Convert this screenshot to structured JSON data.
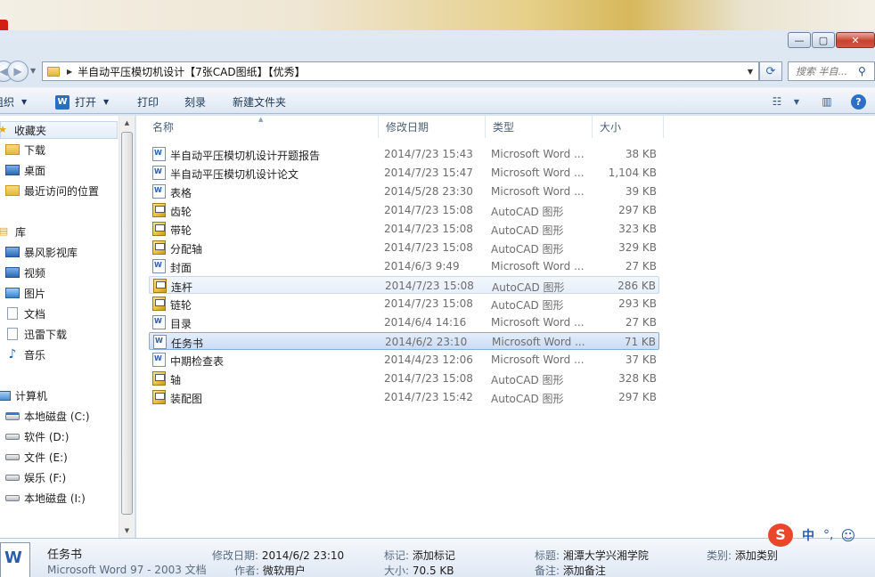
{
  "window": {
    "minimize_glyph": "—",
    "maximize_glyph": "▢",
    "close_glyph": "✕"
  },
  "address": {
    "path": "半自动平压模切机设计【7张CAD图纸】【优秀】",
    "search_placeholder": "搜索 半自..."
  },
  "toolbar": {
    "organize": "组织",
    "open": "打开",
    "print": "打印",
    "burn": "刻录",
    "new_folder": "新建文件夹"
  },
  "navigation": {
    "favorites": "收藏夹",
    "downloads": "下载",
    "desktop": "桌面",
    "recent": "最近访问的位置",
    "libraries": "库",
    "baofeng": "暴风影视库",
    "video": "视频",
    "pictures": "图片",
    "documents": "文档",
    "xunlei": "迅雷下载",
    "music": "音乐",
    "computer": "计算机",
    "drive_c": "本地磁盘 (C:)",
    "drive_d": "软件 (D:)",
    "drive_e": "文件 (E:)",
    "drive_f": "娱乐 (F:)",
    "drive_i": "本地磁盘 (I:)"
  },
  "columns": {
    "name": "名称",
    "modified": "修改日期",
    "type": "类型",
    "size": "大小"
  },
  "files": [
    {
      "name": "半自动平压模切机设计开题报告",
      "date": "2014/7/23 15:43",
      "type": "Microsoft Word ...",
      "size": "38 KB",
      "icon": "word-icon"
    },
    {
      "name": "半自动平压模切机设计论文",
      "date": "2014/7/23 15:47",
      "type": "Microsoft Word ...",
      "size": "1,104 KB",
      "icon": "word-icon"
    },
    {
      "name": "表格",
      "date": "2014/5/28 23:30",
      "type": "Microsoft Word ...",
      "size": "39 KB",
      "icon": "word-icon"
    },
    {
      "name": "齿轮",
      "date": "2014/7/23 15:08",
      "type": "AutoCAD 图形",
      "size": "297 KB",
      "icon": "autocad-icon"
    },
    {
      "name": "带轮",
      "date": "2014/7/23 15:08",
      "type": "AutoCAD 图形",
      "size": "323 KB",
      "icon": "autocad-icon"
    },
    {
      "name": "分配轴",
      "date": "2014/7/23 15:08",
      "type": "AutoCAD 图形",
      "size": "329 KB",
      "icon": "autocad-icon"
    },
    {
      "name": "封面",
      "date": "2014/6/3 9:49",
      "type": "Microsoft Word ...",
      "size": "27 KB",
      "icon": "word-icon"
    },
    {
      "name": "连杆",
      "date": "2014/7/23 15:08",
      "type": "AutoCAD 图形",
      "size": "286 KB",
      "icon": "autocad-icon"
    },
    {
      "name": "链轮",
      "date": "2014/7/23 15:08",
      "type": "AutoCAD 图形",
      "size": "293 KB",
      "icon": "autocad-icon"
    },
    {
      "name": "目录",
      "date": "2014/6/4 14:16",
      "type": "Microsoft Word ...",
      "size": "27 KB",
      "icon": "word-icon"
    },
    {
      "name": "任务书",
      "date": "2014/6/2 23:10",
      "type": "Microsoft Word ...",
      "size": "71 KB",
      "icon": "word-icon"
    },
    {
      "name": "中期检查表",
      "date": "2014/4/23 12:06",
      "type": "Microsoft Word ...",
      "size": "37 KB",
      "icon": "word-icon"
    },
    {
      "name": "轴",
      "date": "2014/7/23 15:08",
      "type": "AutoCAD 图形",
      "size": "328 KB",
      "icon": "autocad-icon"
    },
    {
      "name": "装配图",
      "date": "2014/7/23 15:42",
      "type": "AutoCAD 图形",
      "size": "297 KB",
      "icon": "autocad-icon"
    }
  ],
  "details": {
    "name": "任务书",
    "kind": "Microsoft Word 97 - 2003 文档",
    "modified_label": "修改日期:",
    "modified_value": "2014/6/2 23:10",
    "author_label": "作者:",
    "author_value": "微软用户",
    "tags_label": "标记:",
    "tags_value": "添加标记",
    "size_label": "大小:",
    "size_value": "70.5 KB",
    "title_label": "标题:",
    "title_value": "湘潭大学兴湘学院",
    "notes_label": "备注:",
    "notes_value": "添加备注",
    "category_label": "类别:",
    "category_value": "添加类别"
  },
  "ime": {
    "logo": "S",
    "mode": "中",
    "punct": "°,",
    "face": "☺"
  },
  "colors": {
    "selected_row": "#cadcf5",
    "toolbar_text": "#1e395b",
    "ime_red": "#e9462a"
  }
}
